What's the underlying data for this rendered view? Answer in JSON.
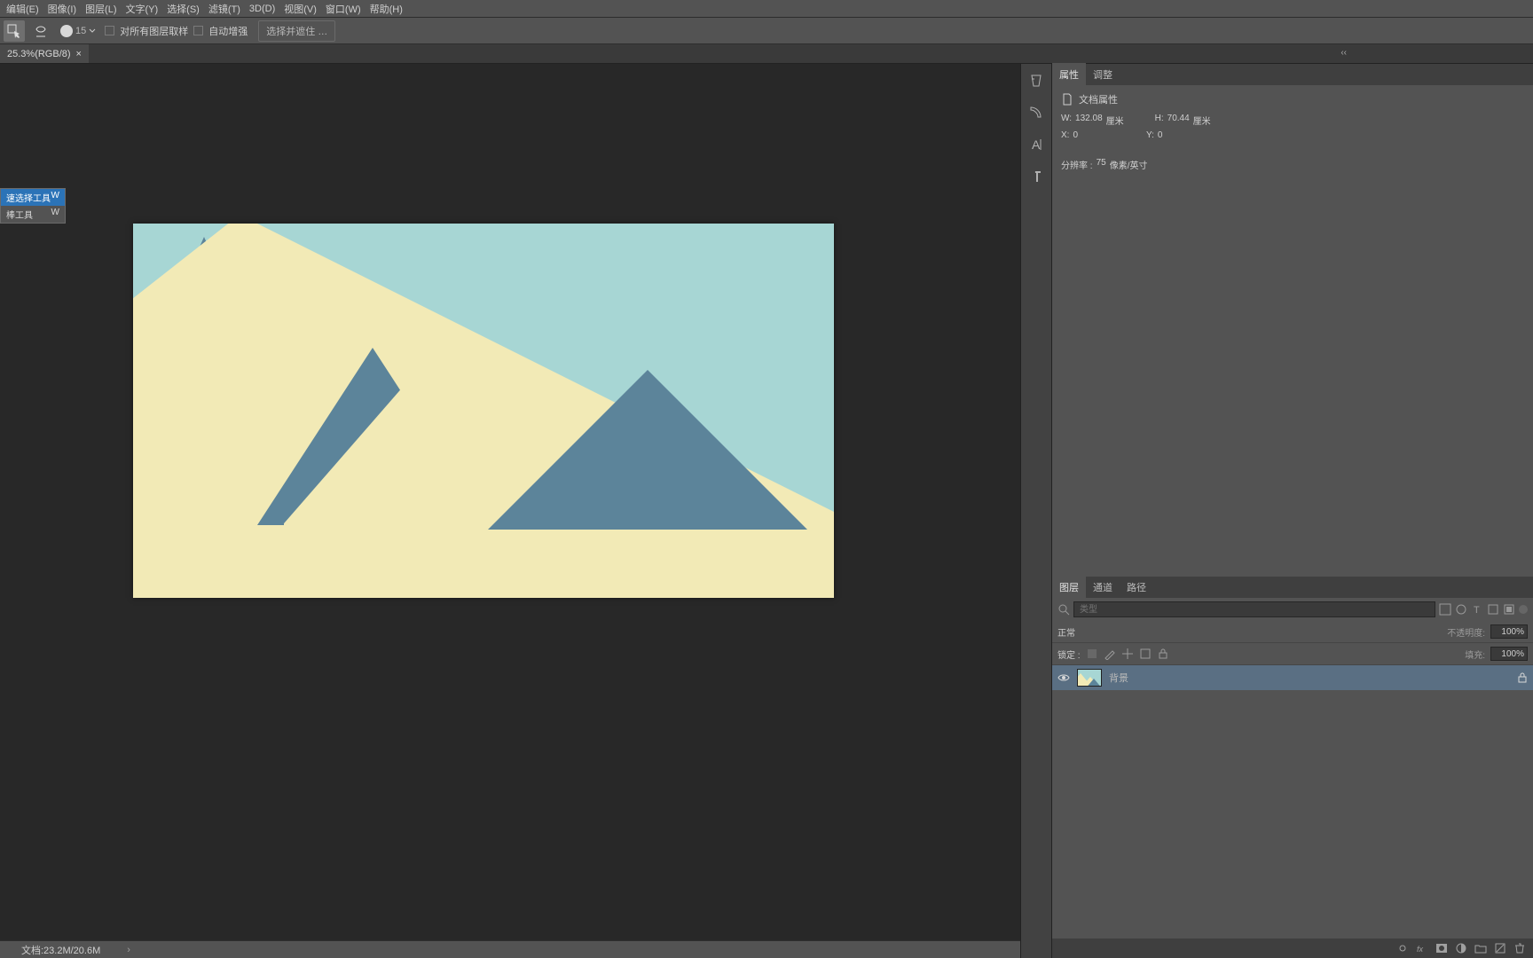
{
  "menu": [
    "编辑(E)",
    "图像(I)",
    "图层(L)",
    "文字(Y)",
    "选择(S)",
    "滤镜(T)",
    "3D(D)",
    "视图(V)",
    "窗口(W)",
    "帮助(H)"
  ],
  "options": {
    "brush_size": "15",
    "all_layers": "对所有图层取样",
    "auto_enhance": "自动增强",
    "select_mask": "选择并遮住 …"
  },
  "tab": {
    "title": "25.3%(RGB/8)"
  },
  "tool_fly": {
    "rows": [
      {
        "name": "快速选择工具",
        "key": "W"
      },
      {
        "name": "魔棒工具",
        "key": "W"
      }
    ],
    "highlighted": 0,
    "truncated_first": "速选择工具",
    "truncated_second": "棒工具"
  },
  "status": {
    "text": "文档:23.2M/20.6M"
  },
  "panels": {
    "properties_tab": "属性",
    "adjustments_tab": "调整",
    "doc_props": "文档属性",
    "w_label": "W:",
    "w_val": "132.08",
    "w_unit": "厘米",
    "h_label": "H:",
    "h_val": "70.44",
    "h_unit": "厘米",
    "x_label": "X:",
    "x_val": "0",
    "y_label": "Y:",
    "y_val": "0",
    "res_label": "分辨率 :",
    "res_val": "75",
    "res_unit": "像素/英寸",
    "layers_tab": "图层",
    "channels_tab": "通道",
    "paths_tab": "路径"
  },
  "layers": {
    "filter_placeholder": "类型",
    "filter_icon": "🔍",
    "blend_mode": "正常",
    "opacity_label": "不透明度:",
    "opacity_val": "100%",
    "lock_label": "锁定 :",
    "fill_label": "填充:",
    "fill_val": "100%",
    "layer_name": "背景"
  },
  "colors": {
    "sky": "#a7d6d4",
    "sand": "#f2eab6",
    "dark": "#5c849a"
  }
}
